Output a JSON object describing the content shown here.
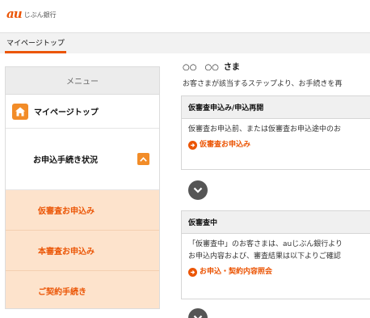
{
  "brand": {
    "logo_mark": "au",
    "logo_text": "じぶん銀行",
    "accent": "#eb5505"
  },
  "topbar": {
    "tab_label": "マイページトップ"
  },
  "sidebar": {
    "heading": "メニュー",
    "home_label": "マイページトップ",
    "home_icon": "home-icon",
    "status_label": "お申込手続き状況",
    "status_icon": "chevron-up-icon",
    "items": [
      {
        "label": "仮審査お申込み"
      },
      {
        "label": "本審査お申込み"
      },
      {
        "label": "ご契約手続き"
      }
    ]
  },
  "main": {
    "greeting_name": "○○　○○",
    "greeting_suffix": "さま",
    "intro": "お客さまが該当するステップより、お手続きを再",
    "cards": [
      {
        "title": "仮審査申込み/申込再開",
        "body_lines": [
          "仮審査お申込前、または仮審査お申込途中のお"
        ],
        "link": "仮審査お申込み"
      },
      {
        "title": "仮審査中",
        "body_lines": [
          "「仮審査中」のお客さまは、auじぶん銀行より",
          "お申込内容および、審査結果は以下よりご確認"
        ],
        "link": "お申込・契約内容照会"
      }
    ]
  }
}
